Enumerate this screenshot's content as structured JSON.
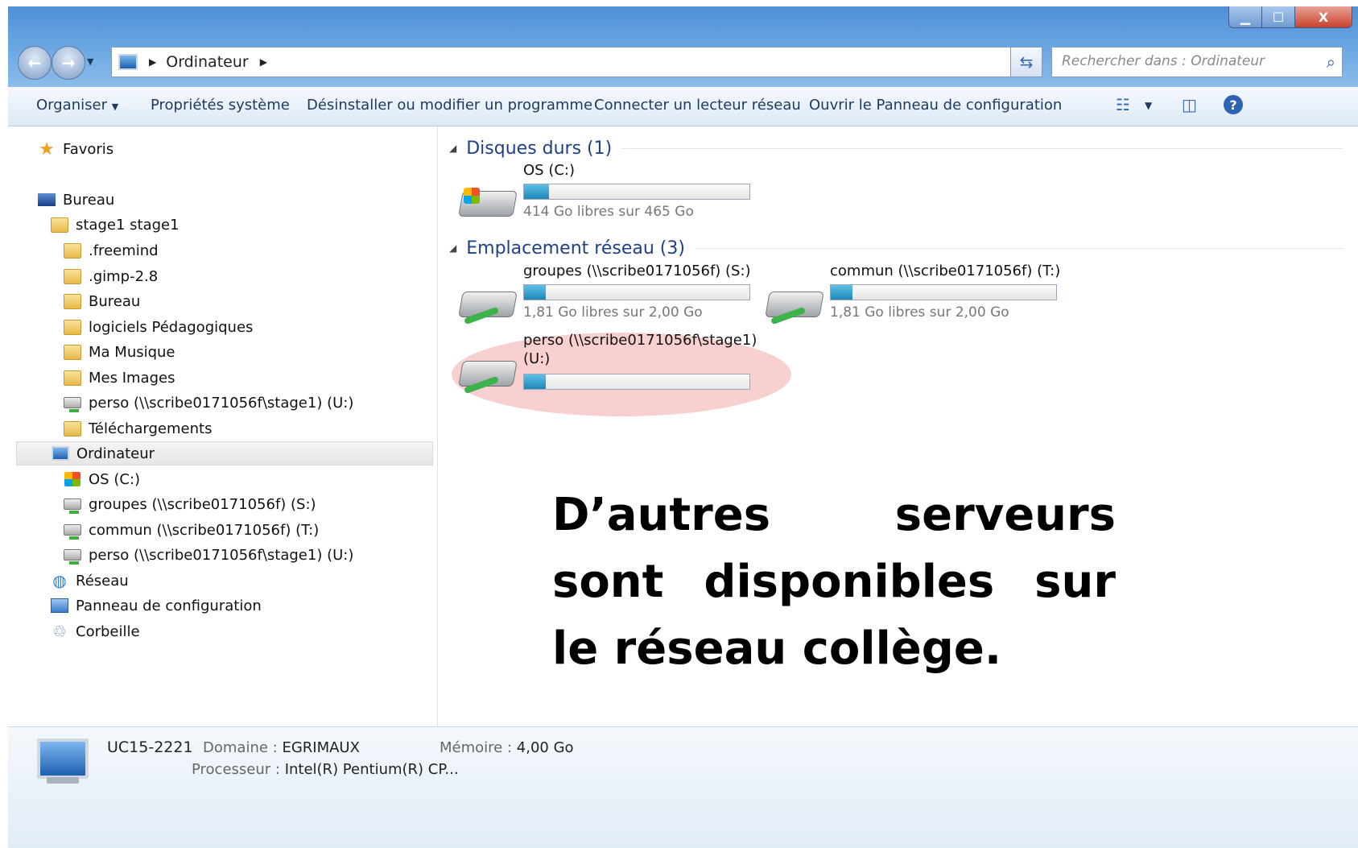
{
  "window": {
    "controls": {
      "minimize": "▁",
      "maximize": "☐",
      "close": "X"
    }
  },
  "address": {
    "path": "Ordinateur"
  },
  "search": {
    "placeholder": "Rechercher dans : Ordinateur"
  },
  "toolbar": {
    "organize": "Organiser",
    "system_properties": "Propriétés système",
    "uninstall": "Désinstaller ou modifier un programme",
    "map_drive": "Connecter un lecteur réseau",
    "control_panel": "Ouvrir le Panneau de configuration"
  },
  "sidebar": {
    "favorites": "Favoris",
    "desktop": "Bureau",
    "user": "stage1 stage1",
    "user_items": [
      ".freemind",
      ".gimp-2.8",
      "Bureau",
      "logiciels Pédagogiques",
      "Ma Musique",
      "Mes Images",
      "perso (\\\\scribe0171056f\\stage1) (U:)",
      "Téléchargements"
    ],
    "computer": "Ordinateur",
    "computer_items": [
      "OS (C:)",
      "groupes (\\\\scribe0171056f) (S:)",
      "commun (\\\\scribe0171056f) (T:)",
      "perso (\\\\scribe0171056f\\stage1) (U:)"
    ],
    "network": "Réseau",
    "control_panel": "Panneau de configuration",
    "recycle_bin": "Corbeille"
  },
  "content": {
    "hard_disks": {
      "title": "Disques durs (1)",
      "drives": [
        {
          "name": "OS (C:)",
          "free": "414 Go libres sur 465 Go",
          "used_fraction": 0.11
        }
      ]
    },
    "network_locations": {
      "title": "Emplacement réseau (3)",
      "drives": [
        {
          "name": "groupes (\\\\scribe0171056f) (S:)",
          "free": "1,81 Go libres sur 2,00 Go",
          "used_fraction": 0.095
        },
        {
          "name": "commun (\\\\scribe0171056f) (T:)",
          "free": "1,81 Go libres sur 2,00 Go",
          "used_fraction": 0.095
        },
        {
          "name_line1": "perso (\\\\scribe0171056f\\stage1)",
          "name_line2": "(U:)",
          "used_fraction": 0.095
        }
      ]
    }
  },
  "annotation": {
    "text": "D’autres serveurs sont disponibles sur le réseau collège."
  },
  "status": {
    "computer_name": "UC15-2221",
    "domain_label": "Domaine :",
    "domain_value": "EGRIMAUX",
    "memory_label": "Mémoire :",
    "memory_value": "4,00 Go",
    "processor_label": "Processeur :",
    "processor_value": "Intel(R) Pentium(R) CP..."
  },
  "colors": {
    "accent": "#1e3f8a",
    "highlight": "#f09696",
    "progress": "#1c87b8"
  }
}
